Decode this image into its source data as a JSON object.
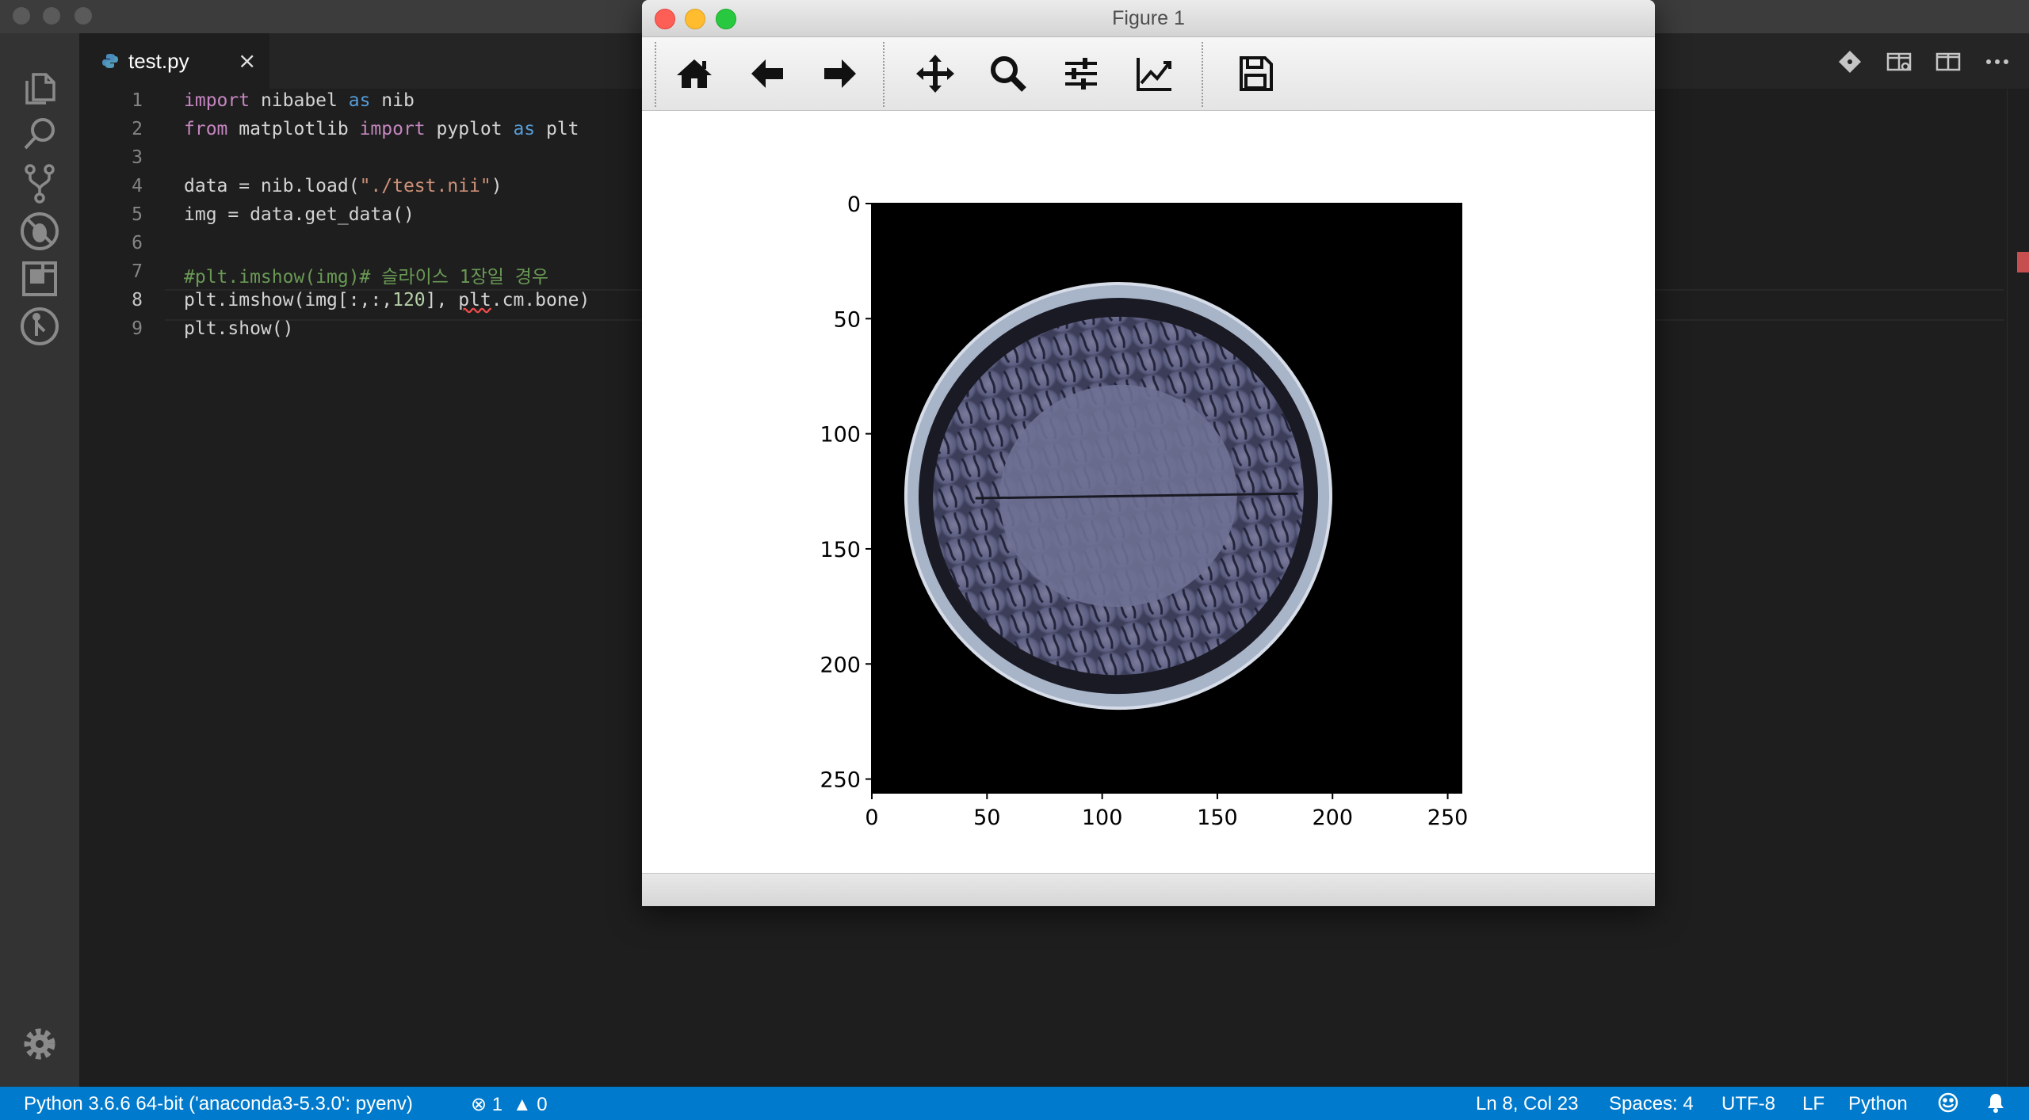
{
  "editor": {
    "tab": {
      "filename": "test.py",
      "close": "×"
    },
    "lines": [
      {
        "n": "1"
      },
      {
        "n": "2"
      },
      {
        "n": "3"
      },
      {
        "n": "4"
      },
      {
        "n": "5"
      },
      {
        "n": "6"
      },
      {
        "n": "7"
      },
      {
        "n": "8"
      },
      {
        "n": "9"
      }
    ],
    "code": {
      "l1_kw": "import",
      "l1_mod": " nibabel ",
      "l1_as": "as",
      "l1_alias": " nib",
      "l2_kw": "from",
      "l2_mod": " matplotlib ",
      "l2_import": "import",
      "l2_sub": " pyplot ",
      "l2_as": "as",
      "l2_alias": " plt",
      "l4_pre": "data = nib.load(",
      "l4_str": "\"./test.nii\"",
      "l4_post": ")",
      "l5": "img = data.get_data()",
      "l7_comment": "#plt.imshow(img)# 슬라이스 1장일 경우",
      "l8_pre": "plt.imshow(img[:,:,",
      "l8_num": "120",
      "l8_mid": "], ",
      "l8_err": "plt",
      "l8_post": ".cm.bone)",
      "l9": "plt.show()"
    }
  },
  "figure": {
    "title": "Figure 1",
    "toolbar": [
      "home-icon",
      "back-arrow-icon",
      "forward-arrow-icon",
      "pan-icon",
      "zoom-icon",
      "configure-subplots-icon",
      "edit-axes-icon",
      "save-icon"
    ]
  },
  "chart_data": {
    "type": "heatmap",
    "colormap": "bone",
    "image_shape": [
      256,
      256
    ],
    "x_ticks": [
      0,
      50,
      100,
      150,
      200,
      250
    ],
    "y_ticks": [
      0,
      50,
      100,
      150,
      200,
      250
    ],
    "xlim": [
      0,
      256
    ],
    "ylim": [
      256,
      0
    ],
    "x_tick_labels": [
      "0",
      "50",
      "100",
      "150",
      "200",
      "250"
    ],
    "y_tick_labels": [
      "0",
      "50",
      "100",
      "150",
      "200",
      "250"
    ]
  },
  "statusbar": {
    "interpreter": "Python 3.6.6 64-bit ('anaconda3-5.3.0': pyenv)",
    "errors": "1",
    "warnings": "0",
    "position": "Ln 8, Col 23",
    "spaces": "Spaces: 4",
    "encoding": "UTF-8",
    "eol": "LF",
    "language": "Python"
  },
  "colors": {
    "statusbar": "#007acc",
    "editor_bg": "#1e1e1e",
    "keyword": "#c586c0",
    "builtin_kw": "#569cd6",
    "string": "#ce9178",
    "comment": "#6a9955"
  }
}
